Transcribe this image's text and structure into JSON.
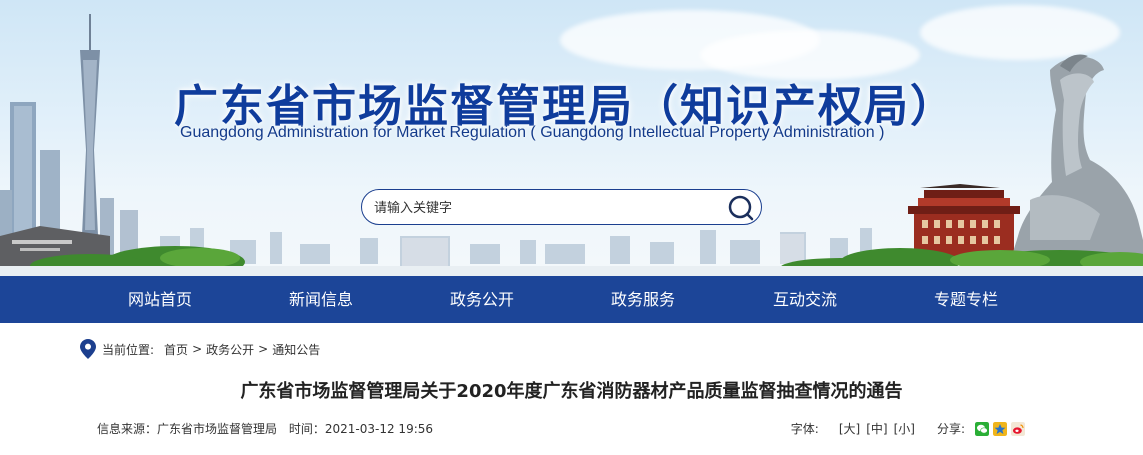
{
  "header": {
    "org_name_cn": "广东省市场监督管理局（知识产权局）",
    "org_name_en": "Guangdong Administration for Market Regulation ( Guangdong Intellectual Property Administration )"
  },
  "search": {
    "placeholder": "请输入关键字",
    "button_icon": "search-icon"
  },
  "nav": {
    "items": [
      {
        "label": "网站首页"
      },
      {
        "label": "新闻信息"
      },
      {
        "label": "政务公开"
      },
      {
        "label": "政务服务"
      },
      {
        "label": "互动交流"
      },
      {
        "label": "专题专栏"
      }
    ],
    "color": "#1c4598"
  },
  "breadcrumb": {
    "prefix": "当前位置:",
    "items": [
      {
        "label": "首页"
      },
      {
        "label": "政务公开"
      },
      {
        "label": "通知公告"
      }
    ],
    "separator": ">"
  },
  "article": {
    "title": "广东省市场监督管理局关于2020年度广东省消防器材产品质量监督抽查情况的通告",
    "source_label": "信息来源：",
    "source": "广东省市场监督管理局",
    "time_label": "时间：",
    "time": "2021-03-12 19:56"
  },
  "tools": {
    "font_label": "字体:",
    "font_sizes": [
      "[大]",
      "[中]",
      "[小]"
    ],
    "share_label": "分享:",
    "share_icons": [
      "wechat-icon",
      "qzone-icon",
      "weibo-icon"
    ]
  }
}
